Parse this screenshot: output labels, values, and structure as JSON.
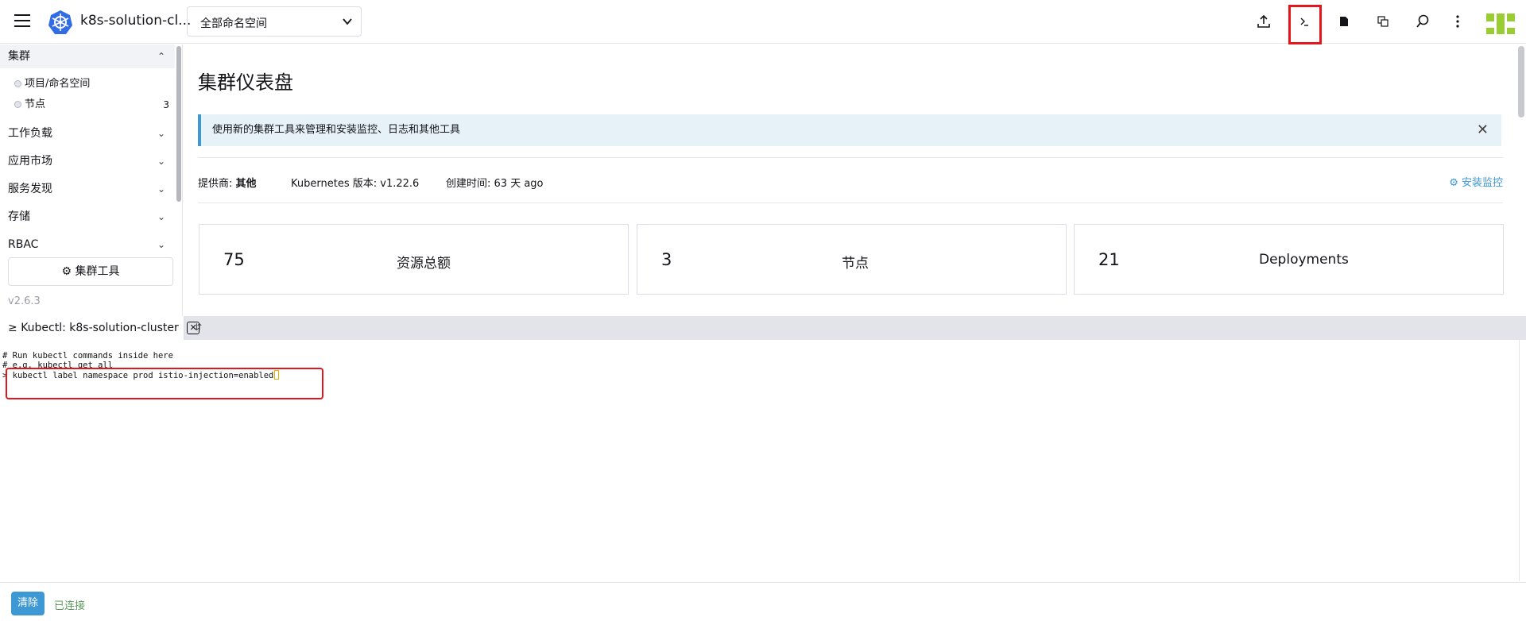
{
  "header": {
    "cluster_name": "k8s-solution-cl...",
    "namespace_selected": "全部命名空间",
    "icons": [
      "upload-icon",
      "kubectl-shell-icon",
      "file-icon",
      "copy-icon",
      "search-icon",
      "more-vertical-icon"
    ]
  },
  "sidebar": {
    "group_cluster": "集群",
    "sub_items": [
      {
        "label": "项目/命名空间",
        "count": ""
      },
      {
        "label": "节点",
        "count": "3"
      }
    ],
    "groups": [
      "工作负载",
      "应用市场",
      "服务发现",
      "存储",
      "RBAC"
    ],
    "tools_button": "集群工具",
    "version": "v2.6.3"
  },
  "main": {
    "title": "集群仪表盘",
    "banner": "使用新的集群工具来管理和安装监控、日志和其他工具",
    "meta": {
      "provider_label": "提供商:",
      "provider_value": "其他",
      "k8s_label": "Kubernetes 版本:",
      "k8s_value": "v1.22.6",
      "created_label": "创建时间:",
      "created_value": "63 天 ago"
    },
    "install_monitoring": "安装监控",
    "stats": [
      {
        "value": "75",
        "label": "资源总额"
      },
      {
        "value": "3",
        "label": "节点"
      },
      {
        "value": "21",
        "label": "Deployments"
      }
    ]
  },
  "shell": {
    "tab_label": "Kubectl: k8s-solution-cluster",
    "lines": [
      "# Run kubectl commands inside here",
      "# e.g. kubectl get all"
    ],
    "prompt": ">",
    "command": "kubectl label namespace prod istio-injection=enabled",
    "clear_button": "清除",
    "status": "已连接"
  },
  "colors": {
    "accent": "#3d98d3",
    "highlight": "#e5161b",
    "connected": "#5d995d"
  }
}
